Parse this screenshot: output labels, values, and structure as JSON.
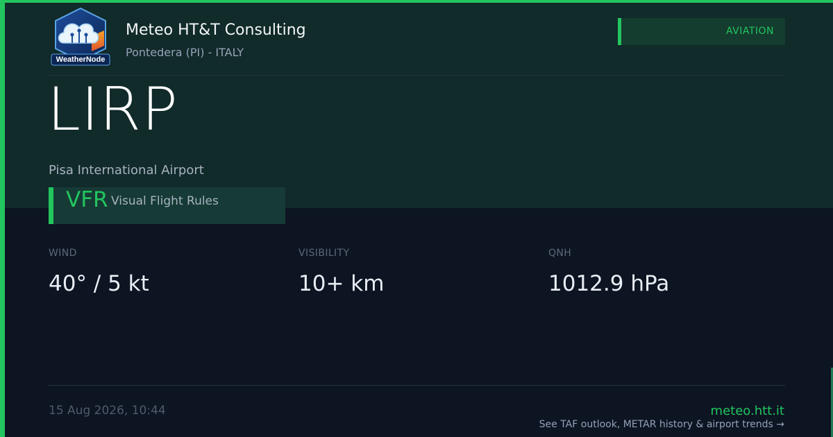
{
  "brand": {
    "logo_text": "WeatherNode",
    "org_name": "Meteo HT&T Consulting",
    "location": "Pontedera (PI) - ITALY"
  },
  "badge": {
    "label": "AVIATION"
  },
  "station": {
    "icao": "LIRP",
    "name": "Pisa International Airport"
  },
  "flight_rules": {
    "code": "VFR",
    "description": "Visual Flight Rules"
  },
  "metrics": [
    {
      "label": "WIND",
      "value": "40° / 5 kt"
    },
    {
      "label": "VISIBILITY",
      "value": "10+ km"
    },
    {
      "label": "QNH",
      "value": "1012.9 hPa"
    }
  ],
  "footer": {
    "timestamp": "15 Aug 2026, 10:44",
    "site": "meteo.htt.it",
    "cta": "See TAF outlook, METAR history & airport trends →"
  },
  "colors": {
    "accent": "#22c55e",
    "top_band": "#112a2a",
    "background": "#0d1422"
  },
  "icons": {
    "logo": "weathernode-cloud-circuit-icon"
  }
}
